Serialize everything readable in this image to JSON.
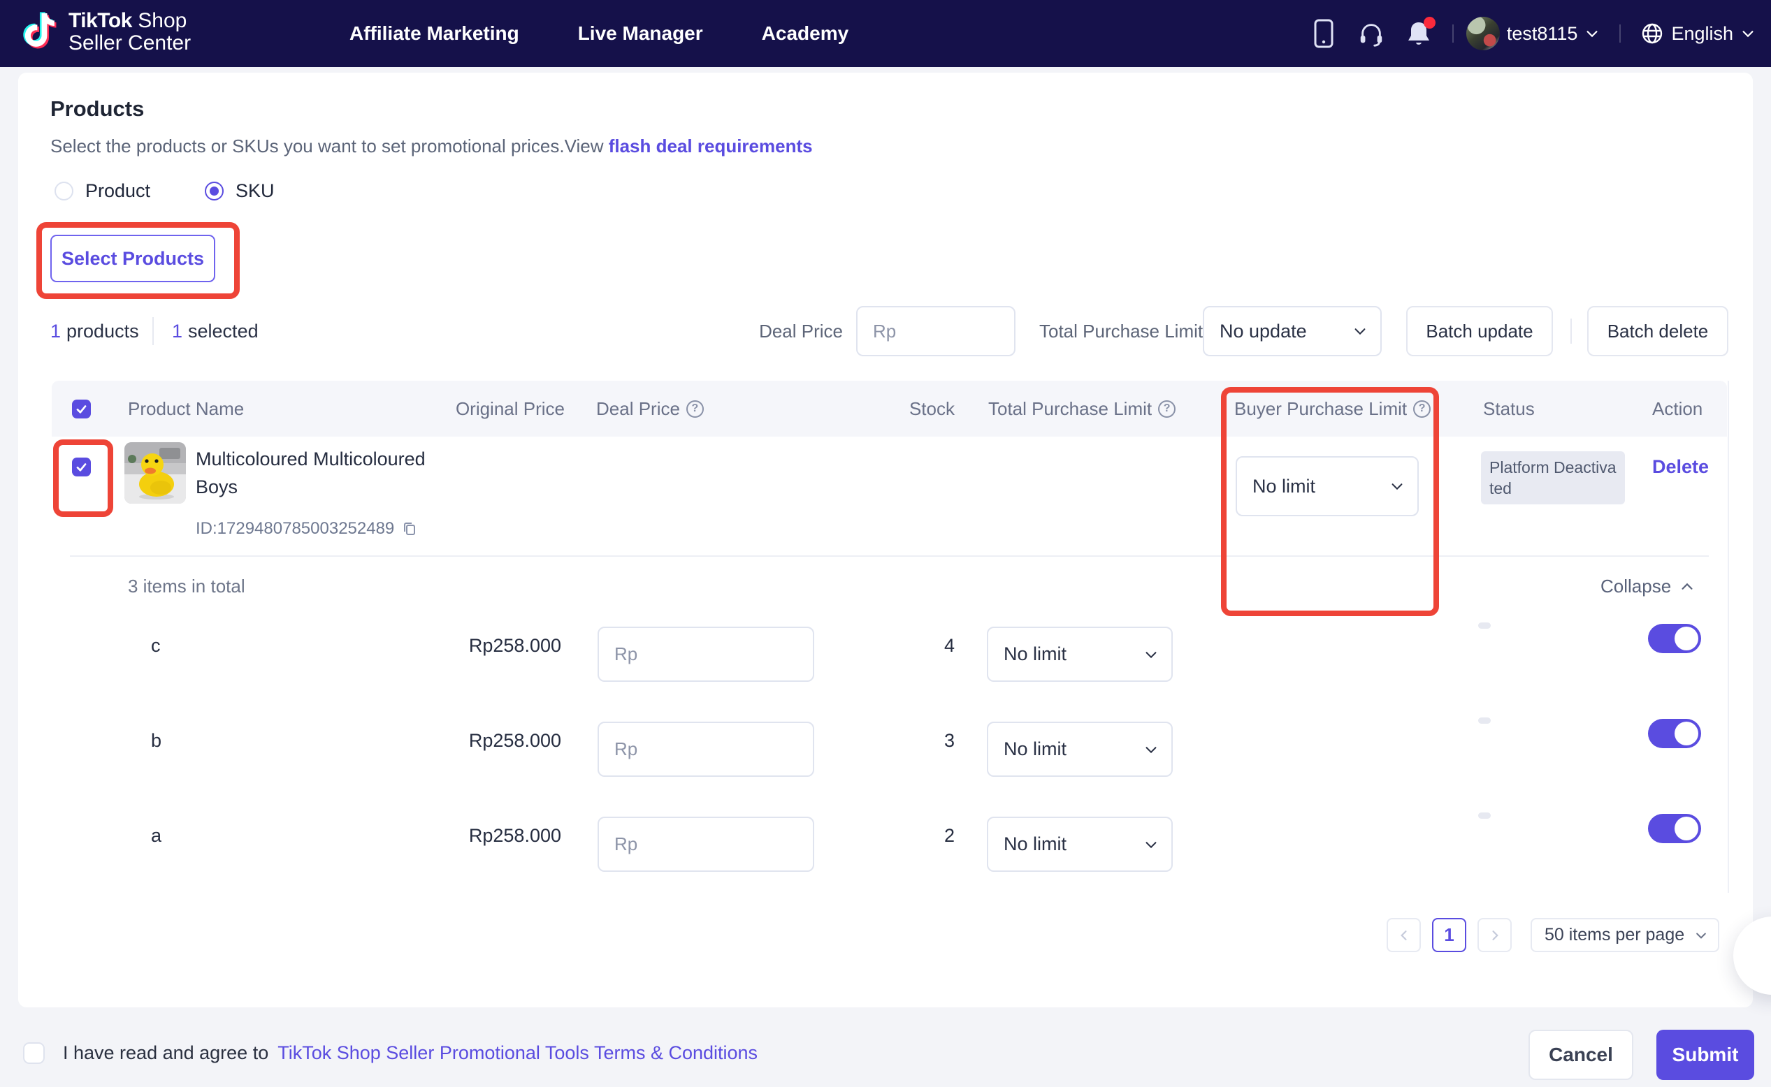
{
  "navbar": {
    "logo": {
      "brand_bold": "TikTok",
      "brand_light": "Shop",
      "line2": "Seller Center"
    },
    "links": [
      "Affiliate Marketing",
      "Live Manager",
      "Academy"
    ],
    "username": "test8115",
    "language": "English"
  },
  "page": {
    "title": "Products",
    "subtitle": "Select the products or SKUs you want to set promotional prices.View",
    "subtitle_link": "flash deal requirements",
    "radios": {
      "product": "Product",
      "sku": "SKU"
    },
    "select_products": "Select Products"
  },
  "summary": {
    "products_count": "1",
    "products_label": "products",
    "selected_count": "1",
    "selected_label": "selected"
  },
  "toolbar": {
    "deal_price_label": "Deal Price",
    "deal_price_placeholder": "Rp",
    "total_limit_label": "Total Purchase Limit",
    "total_limit_value": "No update",
    "batch_update": "Batch update",
    "batch_delete": "Batch delete"
  },
  "table": {
    "headers": {
      "product_name": "Product Name",
      "original_price": "Original Price",
      "deal_price": "Deal Price",
      "stock": "Stock",
      "total_purchase_limit": "Total Purchase Limit",
      "buyer_purchase_limit": "Buyer Purchase Limit",
      "status": "Status",
      "action": "Action"
    },
    "product": {
      "name": "Multicoloured Multicoloured Boys",
      "id": "ID:1729480785003252489",
      "buyer_limit": "No limit",
      "status": "Platform Deactivated",
      "action": "Delete"
    },
    "items_total": "3 items in total",
    "collapse_label": "Collapse",
    "skus": [
      {
        "name": "c",
        "original_price": "Rp258.000",
        "deal_placeholder": "Rp",
        "stock": "4",
        "total_limit": "No limit"
      },
      {
        "name": "b",
        "original_price": "Rp258.000",
        "deal_placeholder": "Rp",
        "stock": "3",
        "total_limit": "No limit"
      },
      {
        "name": "a",
        "original_price": "Rp258.000",
        "deal_placeholder": "Rp",
        "stock": "2",
        "total_limit": "No limit"
      }
    ]
  },
  "pagination": {
    "current_page": "1",
    "page_size": "50 items per page"
  },
  "footer": {
    "agreement_text": "I have read and agree to",
    "terms_link": "TikTok Shop Seller Promotional Tools Terms & Conditions",
    "cancel": "Cancel",
    "submit": "Submit"
  },
  "icons": {
    "question": "?"
  },
  "colors": {
    "accent": "#5a4ce0",
    "annotation_red": "#ee4437",
    "navbar_bg": "#15114a"
  }
}
